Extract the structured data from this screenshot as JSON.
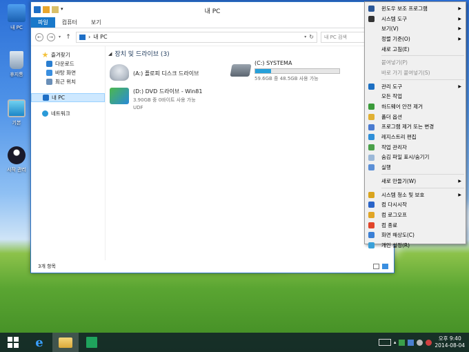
{
  "desktop": {
    "icons": [
      {
        "label": "내 PC"
      },
      {
        "label": "휴지통"
      },
      {
        "label": "기본"
      },
      {
        "label": "시작 관리"
      }
    ]
  },
  "window": {
    "title": "내 PC",
    "tabs": [
      {
        "label": "파일",
        "active": true
      },
      {
        "label": "컴퓨터",
        "active": false
      },
      {
        "label": "보기",
        "active": false
      }
    ],
    "address": {
      "separator": "›",
      "path": "내 PC"
    },
    "search_placeholder": "내 PC 검색",
    "nav": {
      "favorites": "즐겨찾기",
      "downloads": "다운로드",
      "desktop": "바탕 화면",
      "recent": "최근 위치",
      "this_pc": "내 PC",
      "network": "네트워크"
    },
    "section_title": "장치 및 드라이브 (3)",
    "drives": [
      {
        "name": "(A:) 플로피 디스크 드라이브",
        "detail": "",
        "fs": ""
      },
      {
        "name": "(C:) SYSTEMA",
        "detail": "59.6GB 중 48.5GB 사용 가능",
        "fs": "",
        "used_percent": 19
      },
      {
        "name": "(D:) DVD 드라이브 - Win81",
        "detail": "3.90GB 중 0바이트 사용 가능",
        "fs": "UDF"
      }
    ],
    "status": "3개 항목"
  },
  "context_menu": {
    "items": [
      {
        "label": "윈도우 보조 프로그램",
        "submenu": true,
        "disabled": false,
        "icon": "accessories-icon",
        "color": "#2b5797"
      },
      {
        "label": "시스템 도구",
        "submenu": true,
        "disabled": false,
        "icon": "system-tools-icon",
        "color": "#333333"
      },
      {
        "label": "보기(V)",
        "submenu": true,
        "disabled": false
      },
      {
        "label": "정렬 기준(O)",
        "submenu": true,
        "disabled": false
      },
      {
        "label": "새로 고침(E)",
        "submenu": false,
        "disabled": false
      },
      {
        "sep": true
      },
      {
        "label": "붙여넣기(P)",
        "submenu": false,
        "disabled": true
      },
      {
        "label": "바로 가기 붙여넣기(S)",
        "submenu": false,
        "disabled": true
      },
      {
        "sep": true
      },
      {
        "label": "관리 도구",
        "submenu": true,
        "disabled": false,
        "icon": "admin-tools-icon",
        "color": "#1c6fc2"
      },
      {
        "label": "모든 작업",
        "submenu": false,
        "disabled": false
      },
      {
        "label": "하드웨어 안전 제거",
        "submenu": false,
        "disabled": false,
        "icon": "safe-remove-icon",
        "color": "#3a9a3a"
      },
      {
        "label": "폴더 옵션",
        "submenu": false,
        "disabled": false,
        "icon": "folder-options-icon",
        "color": "#e0b033"
      },
      {
        "label": "프로그램 제거 또는 변경",
        "submenu": false,
        "disabled": false,
        "icon": "programs-icon",
        "color": "#4a7bd0"
      },
      {
        "label": "레지스트리 편집",
        "submenu": false,
        "disabled": false,
        "icon": "registry-icon",
        "color": "#2f8fd8"
      },
      {
        "label": "작업 관리자",
        "submenu": false,
        "disabled": false,
        "icon": "task-manager-icon",
        "color": "#4aa04a"
      },
      {
        "label": "숨김 파일 표시/숨기기",
        "submenu": false,
        "disabled": false,
        "icon": "hidden-files-icon",
        "color": "#9bb8d8"
      },
      {
        "label": "실행",
        "submenu": false,
        "disabled": false,
        "icon": "run-icon",
        "color": "#5b8fd6"
      },
      {
        "sep": true
      },
      {
        "label": "새로 만들기(W)",
        "submenu": true,
        "disabled": false
      },
      {
        "sep": true
      },
      {
        "label": "시스템 청소 및 보호",
        "submenu": true,
        "disabled": false,
        "icon": "shield-icon",
        "color": "#d9a41e"
      },
      {
        "label": "컴 다시시작",
        "submenu": false,
        "disabled": false,
        "icon": "restart-icon",
        "color": "#2a64c8"
      },
      {
        "label": "컴 로그오프",
        "submenu": false,
        "disabled": false,
        "icon": "logoff-icon",
        "color": "#e0a526"
      },
      {
        "label": "컴 종료",
        "submenu": false,
        "disabled": false,
        "icon": "shutdown-icon",
        "color": "#e0452a"
      },
      {
        "label": "화면 해상도(C)",
        "submenu": false,
        "disabled": false,
        "icon": "display-icon",
        "color": "#3b7fd4"
      },
      {
        "label": "개인 설정(R)",
        "submenu": false,
        "disabled": false,
        "icon": "personalize-icon",
        "color": "#3aa0d8"
      }
    ]
  },
  "taskbar": {
    "clock_time": "오후 9:40",
    "clock_date": "2014-08-04"
  }
}
